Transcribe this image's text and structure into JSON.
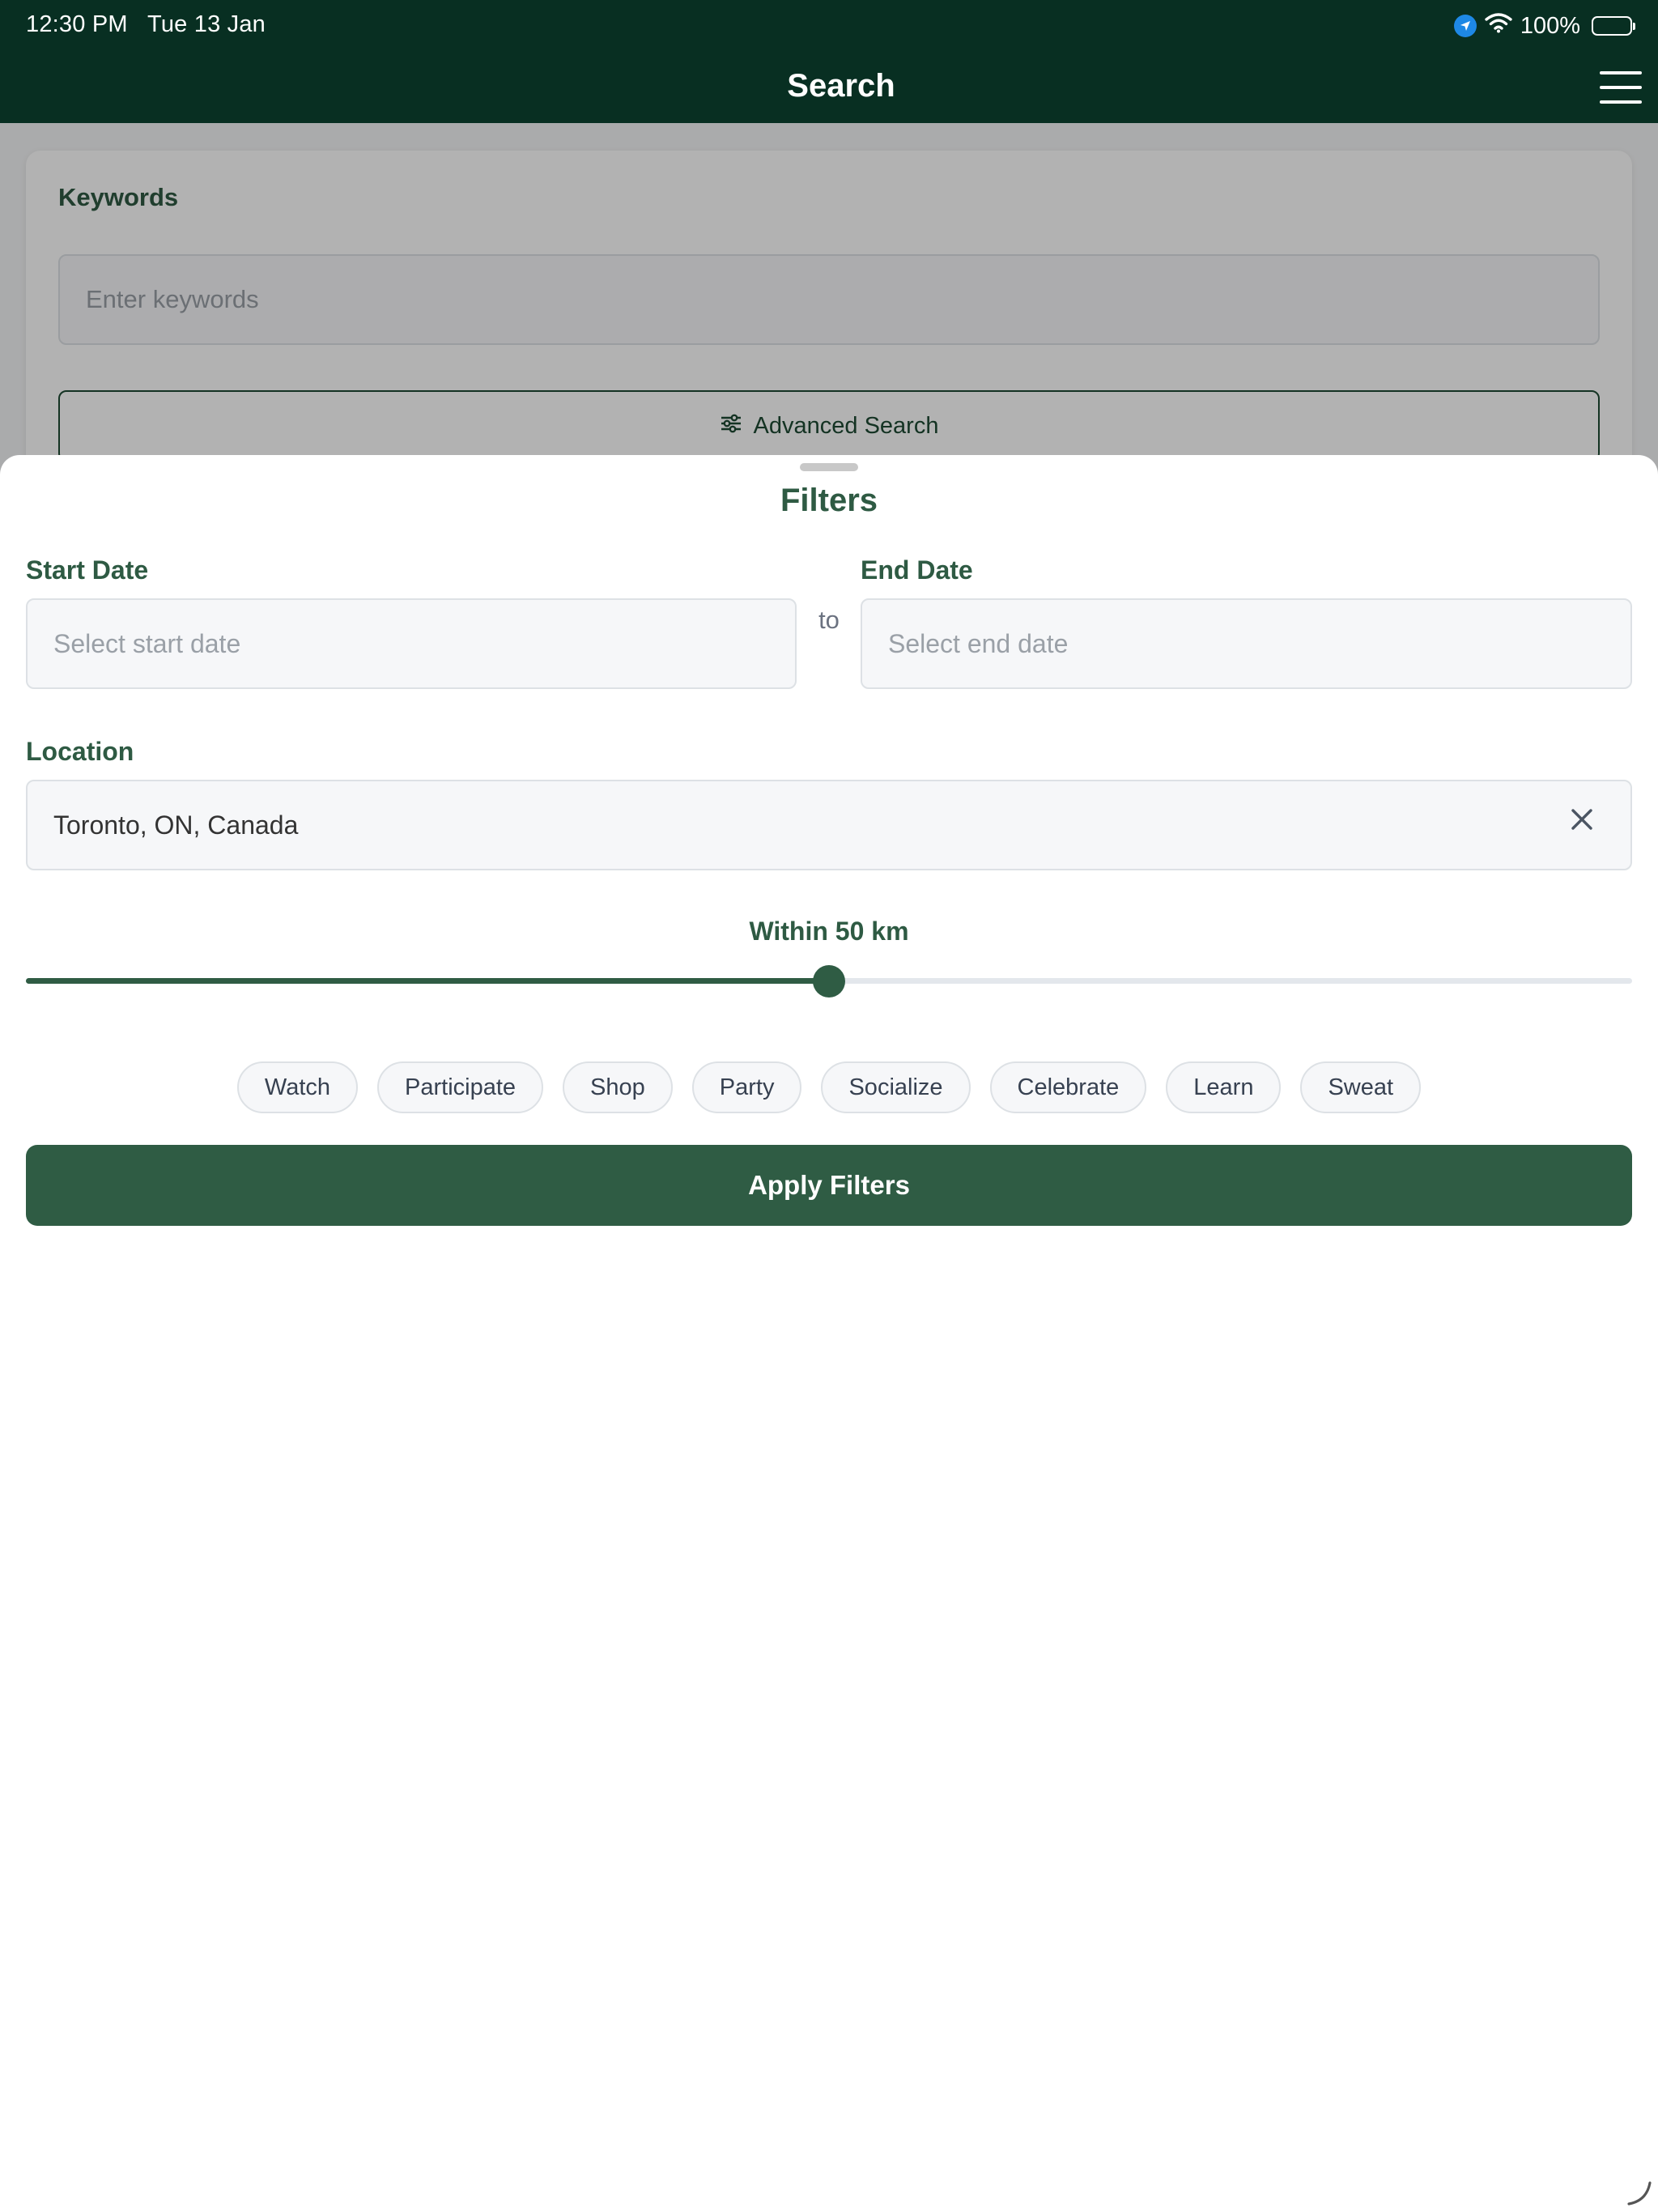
{
  "status_bar": {
    "time": "12:30 PM",
    "date": "Tue 13 Jan",
    "battery": "100%",
    "battery_level": 1.0
  },
  "nav": {
    "title": "Search",
    "menu_icon": "hamburger-menu-icon"
  },
  "search_form": {
    "keywords_label": "Keywords",
    "keywords_placeholder": "Enter keywords",
    "keywords_value": "",
    "advanced_label": "Advanced Search",
    "advanced_icon": "sliders-icon"
  },
  "filters": {
    "title": "Filters",
    "start_date_label": "Start Date",
    "start_date_placeholder": "Select start date",
    "end_date_label": "End Date",
    "end_date_placeholder": "Select end date",
    "range_separator": "to",
    "location_label": "Location",
    "location_value": "Toronto, ON, Canada",
    "radius_label": "Within 50 km",
    "radius_fraction": 0.5,
    "categories": [
      "Watch",
      "Participate",
      "Shop",
      "Party",
      "Socialize",
      "Celebrate",
      "Learn",
      "Sweat"
    ],
    "apply_label": "Apply Filters"
  },
  "colors": {
    "header_bg": "#082f22",
    "accent": "#2f5c44",
    "label": "#2e5a43",
    "location_dot": "#1e88e5"
  }
}
